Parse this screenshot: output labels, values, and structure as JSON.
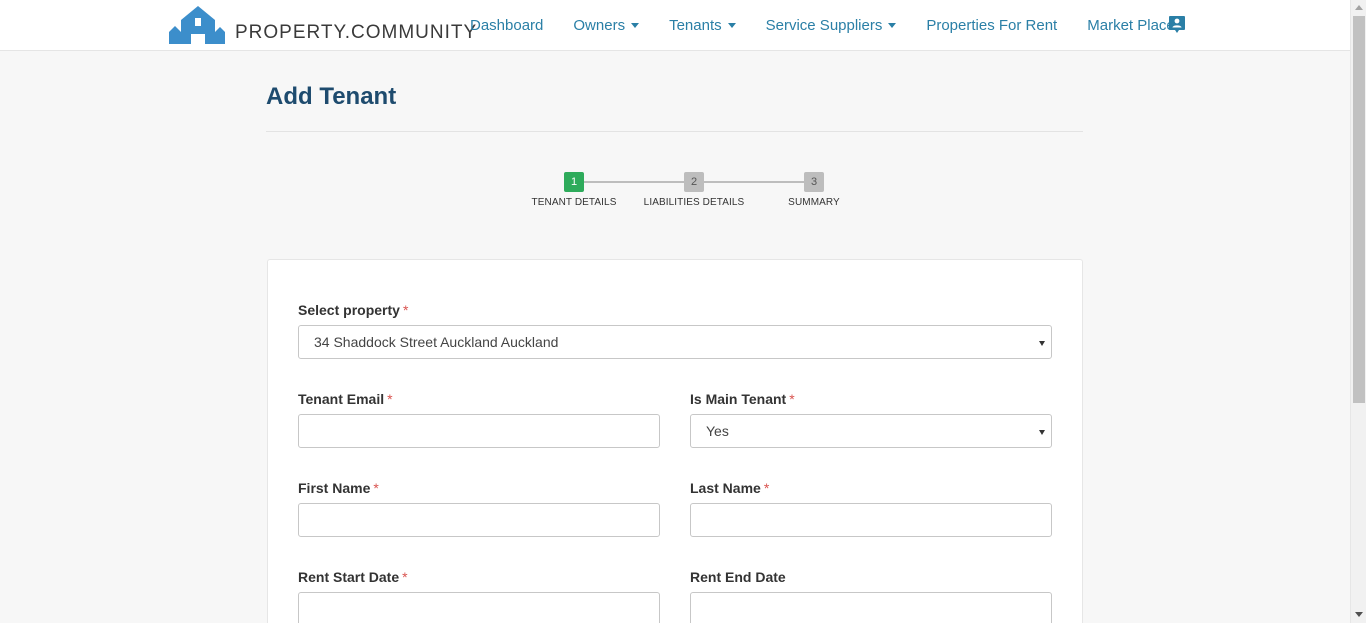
{
  "brand": {
    "name": "PROPERTY.COMMUNITY",
    "logo_color": "#3c8ecb"
  },
  "nav": {
    "items": [
      {
        "label": "Dashboard",
        "dropdown": false
      },
      {
        "label": "Owners",
        "dropdown": true
      },
      {
        "label": "Tenants",
        "dropdown": true
      },
      {
        "label": "Service Suppliers",
        "dropdown": true
      },
      {
        "label": "Properties For Rent",
        "dropdown": false
      },
      {
        "label": "Market Place",
        "dropdown": false
      }
    ],
    "profile_icon": "contact-card-icon",
    "link_color": "#2a7fa6"
  },
  "page": {
    "title": "Add Tenant"
  },
  "stepper": {
    "steps": [
      {
        "number": "1",
        "label": "TENANT DETAILS",
        "state": "active"
      },
      {
        "number": "2",
        "label": "LIABILITIES DETAILS",
        "state": "inactive"
      },
      {
        "number": "3",
        "label": "SUMMARY",
        "state": "inactive"
      }
    ],
    "active_color": "#2eab5b",
    "inactive_color": "#bdbdbd"
  },
  "form": {
    "select_property": {
      "label": "Select property",
      "required": "*",
      "value": "34 Shaddock Street Auckland Auckland"
    },
    "tenant_email": {
      "label": "Tenant Email",
      "required": "*",
      "value": ""
    },
    "is_main_tenant": {
      "label": "Is Main Tenant",
      "required": "*",
      "value": "Yes"
    },
    "first_name": {
      "label": "First Name",
      "required": "*",
      "value": ""
    },
    "last_name": {
      "label": "Last Name",
      "required": "*",
      "value": ""
    },
    "rent_start_date": {
      "label": "Rent Start Date",
      "required": "*",
      "value": ""
    },
    "rent_end_date": {
      "label": "Rent End Date",
      "value": ""
    }
  }
}
